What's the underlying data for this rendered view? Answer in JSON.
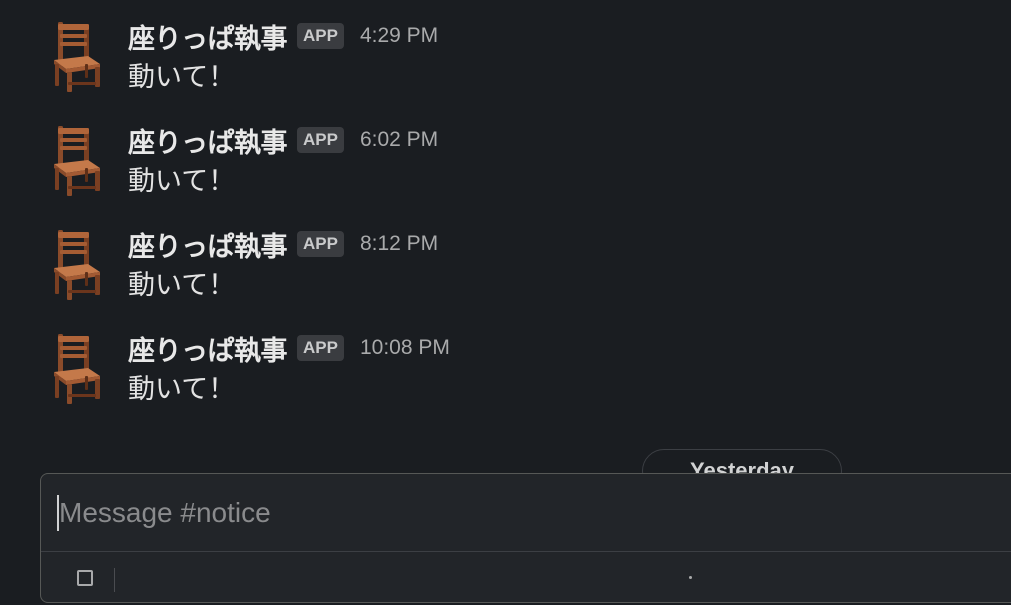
{
  "channel": "notice",
  "messages": [
    {
      "sender": "座りっぱ執事",
      "badge": "APP",
      "time": "4:29 PM",
      "text": "動いて！",
      "avatar_icon": "chair-icon"
    },
    {
      "sender": "座りっぱ執事",
      "badge": "APP",
      "time": "6:02 PM",
      "text": "動いて！",
      "avatar_icon": "chair-icon"
    },
    {
      "sender": "座りっぱ執事",
      "badge": "APP",
      "time": "8:12 PM",
      "text": "動いて！",
      "avatar_icon": "chair-icon"
    },
    {
      "sender": "座りっぱ執事",
      "badge": "APP",
      "time": "10:08 PM",
      "text": "動いて！",
      "avatar_icon": "chair-icon"
    }
  ],
  "date_divider": {
    "label": "Yesterday"
  },
  "composer": {
    "placeholder": "Message #notice",
    "value": ""
  },
  "colors": {
    "background": "#1a1d21",
    "composer_bg": "#222529",
    "sender": "#e8e8e8",
    "timestamp": "#a9aaab",
    "badge_bg": "#3a3c40"
  }
}
